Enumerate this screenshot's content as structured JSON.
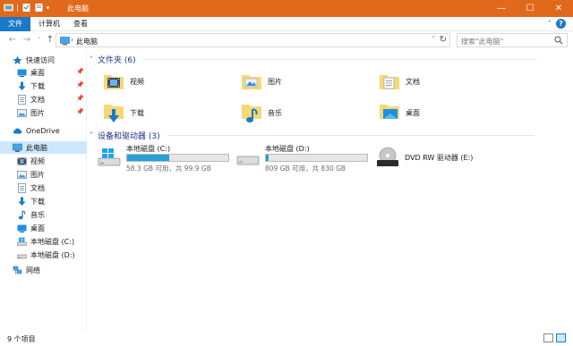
{
  "window": {
    "title": "此电脑",
    "accent": "#e0691b",
    "controls": {
      "minimize": "—",
      "maximize": "☐",
      "close": "✕"
    }
  },
  "ribbon": {
    "tabs": [
      {
        "label": "文件",
        "active": true
      },
      {
        "label": "计算机",
        "active": false
      },
      {
        "label": "查看",
        "active": false
      }
    ],
    "expand": "˅",
    "help": "?"
  },
  "address": {
    "back": "←",
    "forward": "→",
    "recent": "˅",
    "up": "↑",
    "separator": "›",
    "crumb": "此电脑",
    "dropdown": "˅",
    "refresh": "↻"
  },
  "search": {
    "placeholder": "搜索\"此电脑\""
  },
  "sidebar": {
    "pin_glyph": "📌",
    "quick_access": "快速访问",
    "pinned": [
      {
        "label": "桌面",
        "icon": "desktop-icon"
      },
      {
        "label": "下载",
        "icon": "download-icon"
      },
      {
        "label": "文档",
        "icon": "documents-icon"
      },
      {
        "label": "图片",
        "icon": "pictures-icon"
      }
    ],
    "onedrive": "OneDrive",
    "this_pc": "此电脑",
    "pc_items": [
      {
        "label": "视频",
        "icon": "videos-icon"
      },
      {
        "label": "图片",
        "icon": "pictures-icon"
      },
      {
        "label": "文档",
        "icon": "documents-icon"
      },
      {
        "label": "下载",
        "icon": "download-icon"
      },
      {
        "label": "音乐",
        "icon": "music-icon"
      },
      {
        "label": "桌面",
        "icon": "desktop-icon"
      },
      {
        "label": "本地磁盘 (C:)",
        "icon": "windows-drive-icon"
      },
      {
        "label": "本地磁盘 (D:)",
        "icon": "drive-icon"
      }
    ],
    "network": "网络"
  },
  "main": {
    "folders_header": "文件夹 (6)",
    "folders": [
      {
        "label": "视频",
        "icon": "videos-folder-icon"
      },
      {
        "label": "图片",
        "icon": "pictures-folder-icon"
      },
      {
        "label": "文档",
        "icon": "documents-folder-icon"
      },
      {
        "label": "下载",
        "icon": "downloads-folder-icon"
      },
      {
        "label": "音乐",
        "icon": "music-folder-icon"
      },
      {
        "label": "桌面",
        "icon": "desktop-folder-icon"
      }
    ],
    "drives_header": "设备和驱动器 (3)",
    "drives": [
      {
        "label": "本地磁盘 (C:)",
        "info": "58.3 GB 可用，共 99.9 GB",
        "used_fraction": 0.42,
        "icon": "windows-drive-icon"
      },
      {
        "label": "本地磁盘 (D:)",
        "info": "809 GB 可用，共 830 GB",
        "used_fraction": 0.03,
        "icon": "drive-icon"
      },
      {
        "label": "DVD RW 驱动器 (E:)",
        "icon": "dvd-drive-icon",
        "dvd_badge": "DVD"
      }
    ]
  },
  "status": {
    "count": "9 个项目"
  }
}
